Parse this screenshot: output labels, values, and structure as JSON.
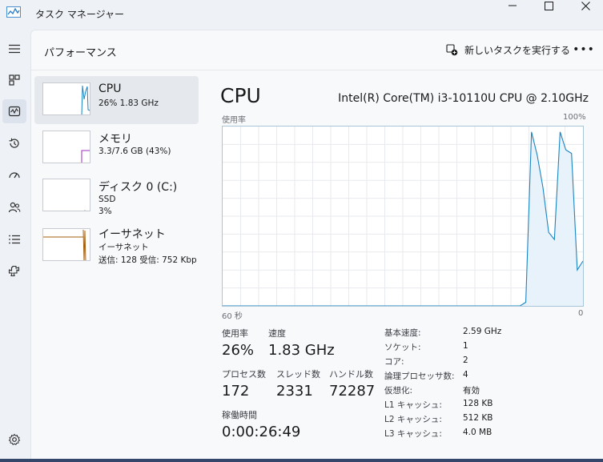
{
  "window": {
    "title": "タスク マネージャー"
  },
  "page": {
    "title": "パフォーマンス",
    "run_new_task": "新しいタスクを実行する",
    "more": "•••"
  },
  "nav": [
    "menu-icon",
    "processes-icon",
    "performance-icon",
    "app-history-icon",
    "startup-icon",
    "users-icon",
    "details-icon",
    "services-icon",
    "settings-icon"
  ],
  "resources": [
    {
      "name": "CPU",
      "line1": "26%  1.83 GHz",
      "line2": "",
      "line3": "",
      "color": "#1b84c2"
    },
    {
      "name": "メモリ",
      "line1": "3.3/7.6 GB (43%)",
      "line2": "",
      "line3": "",
      "color": "#9b2dbf"
    },
    {
      "name": "ディスク 0 (C:)",
      "line1": "SSD",
      "line2": "3%",
      "line3": "",
      "color": "#4e9a24"
    },
    {
      "name": "イーサネット",
      "line1": "イーサネット",
      "line2": "送信: 128  受信: 752 Kbp",
      "line3": "",
      "color": "#a65d0b"
    }
  ],
  "detail": {
    "title": "CPU",
    "model": "Intel(R) Core(TM) i3-10110U CPU @ 2.10GHz",
    "graph_label": "使用率",
    "graph_max": "100%",
    "graph_time": "60 秒",
    "graph_min": "0",
    "stats": {
      "usage_label": "使用率",
      "usage": "26%",
      "speed_label": "速度",
      "speed": "1.83 GHz",
      "processes_label": "プロセス数",
      "processes": "172",
      "threads_label": "スレッド数",
      "threads": "2331",
      "handles_label": "ハンドル数",
      "handles": "72287",
      "uptime_label": "稼働時間",
      "uptime": "0:00:26:49"
    },
    "specs": [
      {
        "label": "基本速度:",
        "value": "2.59 GHz"
      },
      {
        "label": "ソケット:",
        "value": "1"
      },
      {
        "label": "コア:",
        "value": "2"
      },
      {
        "label": "論理プロセッサ数:",
        "value": "4"
      },
      {
        "label": "仮想化:",
        "value": "有効"
      },
      {
        "label": "L1 キャッシュ:",
        "value": "128 KB"
      },
      {
        "label": "L2 キャッシュ:",
        "value": "512 KB"
      },
      {
        "label": "L3 キャッシュ:",
        "value": "4.0 MB"
      }
    ]
  },
  "cpu_history_percent": [
    0,
    0,
    0,
    0,
    0,
    0,
    0,
    0,
    0,
    0,
    0,
    0,
    0,
    0,
    0,
    0,
    0,
    0,
    0,
    0,
    0,
    0,
    0,
    0,
    0,
    0,
    0,
    0,
    0,
    0,
    0,
    0,
    0,
    0,
    0,
    0,
    0,
    0,
    0,
    0,
    0,
    0,
    0,
    0,
    0,
    0,
    0,
    0,
    0,
    0,
    0,
    0,
    0,
    2,
    97,
    84,
    66,
    41,
    37,
    97,
    87,
    85,
    20,
    25
  ]
}
